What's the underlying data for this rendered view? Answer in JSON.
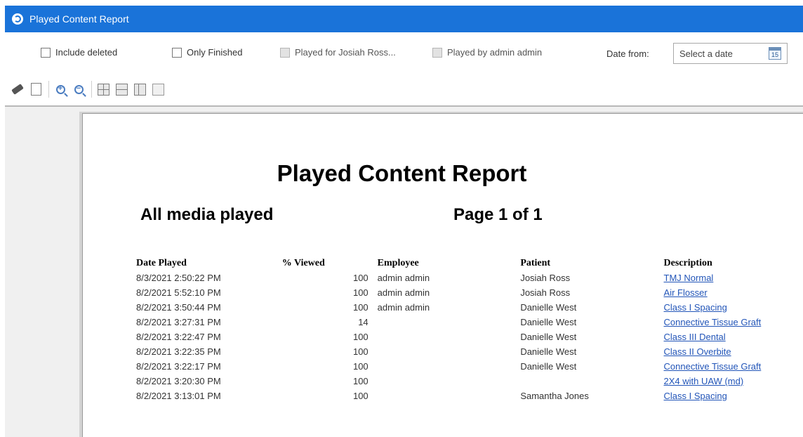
{
  "window": {
    "title": "Played Content Report"
  },
  "filters": {
    "include_deleted": {
      "label": "Include deleted",
      "checked": false,
      "enabled": true
    },
    "only_finished": {
      "label": "Only Finished",
      "checked": false,
      "enabled": true
    },
    "played_for": {
      "label": "Played for Josiah Ross...",
      "checked": false,
      "enabled": false
    },
    "played_by": {
      "label": "Played by admin admin",
      "checked": false,
      "enabled": false
    },
    "date_from_label": "Date from:",
    "date_from_placeholder": "Select a date",
    "calendar_day": "15"
  },
  "toolbar": {
    "icons": [
      "brush-icon",
      "page-setup-icon",
      "zoom-in-icon",
      "zoom-out-icon",
      "layout-four-icon",
      "layout-two-icon",
      "layout-single-icon",
      "layout-blank-icon"
    ]
  },
  "report": {
    "title": "Played Content Report",
    "subtitle": "All media played",
    "page_info": "Page 1 of 1",
    "columns": [
      "Date Played",
      "% Viewed",
      "Employee",
      "Patient",
      "Description"
    ],
    "rows": [
      {
        "date": "8/3/2021 2:50:22 PM",
        "pct": "100",
        "employee": "admin admin",
        "patient": "Josiah Ross",
        "description": "TMJ Normal"
      },
      {
        "date": "8/2/2021 5:52:10 PM",
        "pct": "100",
        "employee": "admin admin",
        "patient": "Josiah Ross",
        "description": "Air Flosser"
      },
      {
        "date": "8/2/2021 3:50:44 PM",
        "pct": "100",
        "employee": "admin admin",
        "patient": "Danielle West",
        "description": "Class I Spacing"
      },
      {
        "date": "8/2/2021 3:27:31 PM",
        "pct": "14",
        "employee": "",
        "patient": "Danielle West",
        "description": "Connective Tissue Graft"
      },
      {
        "date": "8/2/2021 3:22:47 PM",
        "pct": "100",
        "employee": "",
        "patient": "Danielle West",
        "description": "Class III Dental"
      },
      {
        "date": "8/2/2021 3:22:35 PM",
        "pct": "100",
        "employee": "",
        "patient": "Danielle West",
        "description": "Class II Overbite"
      },
      {
        "date": "8/2/2021 3:22:17 PM",
        "pct": "100",
        "employee": "",
        "patient": "Danielle West",
        "description": "Connective Tissue Graft"
      },
      {
        "date": "8/2/2021 3:20:30 PM",
        "pct": "100",
        "employee": "",
        "patient": "",
        "description": "2X4 with UAW (md)"
      },
      {
        "date": "8/2/2021 3:13:01 PM",
        "pct": "100",
        "employee": "",
        "patient": "Samantha Jones",
        "description": "Class I Spacing"
      }
    ]
  }
}
